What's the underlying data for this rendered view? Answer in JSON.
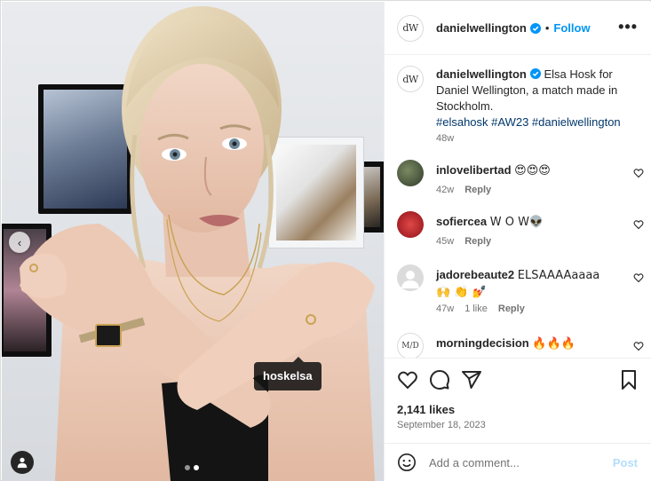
{
  "post": {
    "author": "danielwellington",
    "author_avatar_text": "dW",
    "follow_label": "Follow",
    "separator": "•",
    "caption_text": " Elsa Hosk for Daniel Wellington, a match made in Stockholm.",
    "hashtags": "#elsahosk #AW23 #danielwellington",
    "caption_time": "48w",
    "likes": "2,141 likes",
    "date": "September 18, 2023",
    "more_icon": "•••"
  },
  "media": {
    "tag_label": "hoskelsa",
    "nav_left_icon": "‹",
    "carousel_count": 2,
    "carousel_active": 1
  },
  "comments": [
    {
      "user": "inlovelibertad",
      "text": "😍😍😍",
      "time": "42w",
      "likes": "",
      "reply": "Reply",
      "avatar_color": "#3f4a38"
    },
    {
      "user": "sofiercea",
      "text": "W O W👽",
      "time": "45w",
      "likes": "",
      "reply": "Reply",
      "avatar_color": "#c0262c"
    },
    {
      "user": "jadorebeaute2",
      "text": "ELSAAAAaaaa 🙌 👏 💅",
      "time": "47w",
      "likes": "1 like",
      "reply": "Reply",
      "avatar_color": "#dbdbdb"
    },
    {
      "user": "morningdecision",
      "text": "🔥🔥🔥",
      "time": "",
      "likes": "",
      "reply": "",
      "avatar_color": "#ffffff"
    }
  ],
  "comment_input": {
    "placeholder": "Add a comment...",
    "post_label": "Post"
  },
  "colors": {
    "accent": "#0095f6",
    "hashtag": "#00376b",
    "muted": "#737373",
    "post_disabled": "#b2dffc"
  }
}
